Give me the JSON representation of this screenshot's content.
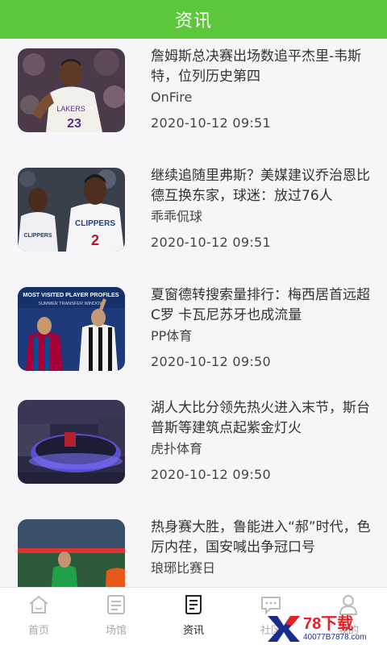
{
  "header": {
    "title": "资讯"
  },
  "articles": [
    {
      "title": "詹姆斯总决赛出场数追平杰里-韦斯特，位列历史第四",
      "source": "OnFire",
      "time": "2020-10-12 09:51"
    },
    {
      "title": "继续追随里弗斯？美媒建议乔治恩比德互换东家，球迷：放过76人",
      "source": "乖乖侃球",
      "time": "2020-10-12 09:51"
    },
    {
      "title": "夏窗德转搜索量排行：梅西居首远超C罗 卡瓦尼苏牙也成流量",
      "source": "PP体育",
      "time": "2020-10-12 09:50"
    },
    {
      "title": "湖人大比分领先热火进入末节，斯台普斯等建筑点起紫金灯火",
      "source": "虎扑体育",
      "time": "2020-10-12 09:50"
    },
    {
      "title": "热身赛大胜，鲁能进入“郝”时代，色厉内荏，国安喊出争冠口号",
      "source": "琅琊比赛日",
      "time": ""
    }
  ],
  "thumbs": {
    "t1": {
      "jersey": "23",
      "team": "LAKERS"
    },
    "t2": {
      "team": "CLIPPERS",
      "jersey": "2"
    },
    "t3": {
      "line1": "MOST VISITED PLAYER PROFILES",
      "line2": "SUMMER TRANSFER WINDOW"
    }
  },
  "tabs": [
    {
      "label": "首页",
      "icon": "home-icon"
    },
    {
      "label": "场馆",
      "icon": "venue-icon"
    },
    {
      "label": "资讯",
      "icon": "news-icon",
      "active": true
    },
    {
      "label": "社区",
      "icon": "chat-icon"
    },
    {
      "label": "我的",
      "icon": "user-icon"
    }
  ],
  "watermark": {
    "big": "78下载",
    "small": "40077B7878.com"
  },
  "colors": {
    "header": "#5cc73a",
    "tab_inactive": "#aaaaaa",
    "tab_active": "#222222",
    "watermark_red": "#e41f26",
    "watermark_blue": "#1a2c8c"
  }
}
